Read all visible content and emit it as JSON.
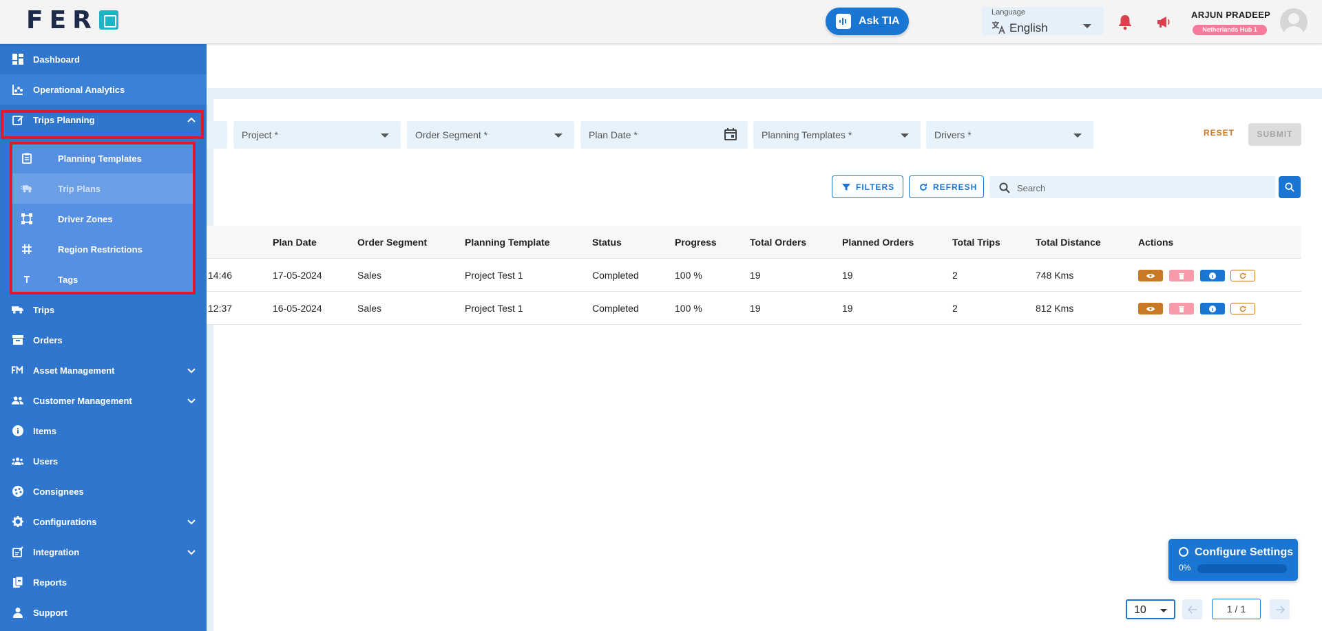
{
  "header": {
    "logo_text": "FER",
    "ask_tia_label": "Ask TIA",
    "language": {
      "caption": "Language",
      "value": "English"
    },
    "user": {
      "name": "ARJUN PRADEEP",
      "badge": "Netherlands Hub 1"
    }
  },
  "sidebar": {
    "items": [
      {
        "label": "Dashboard",
        "icon": "dashboard-icon"
      },
      {
        "label": "Operational Analytics",
        "icon": "analytics-icon"
      },
      {
        "label": "Trips Planning",
        "icon": "trips-planning-icon",
        "expanded": true
      },
      {
        "label": "Trips",
        "icon": "truck-icon"
      },
      {
        "label": "Orders",
        "icon": "orders-box-icon"
      },
      {
        "label": "Asset Management",
        "icon": "fm-icon",
        "expandable": true
      },
      {
        "label": "Customer Management",
        "icon": "people-icon",
        "expandable": true
      },
      {
        "label": "Items",
        "icon": "info-circle-icon"
      },
      {
        "label": "Users",
        "icon": "users-icon"
      },
      {
        "label": "Consignees",
        "icon": "palette-icon"
      },
      {
        "label": "Configurations",
        "icon": "gear-icon",
        "expandable": true
      },
      {
        "label": "Integration",
        "icon": "integration-icon",
        "expandable": true
      },
      {
        "label": "Reports",
        "icon": "reports-icon"
      },
      {
        "label": "Support",
        "icon": "support-icon"
      }
    ],
    "sub_items": [
      {
        "label": "Planning Templates",
        "icon": "clipboard-icon"
      },
      {
        "label": "Trip Plans",
        "icon": "truck-fast-icon",
        "active": true
      },
      {
        "label": "Driver Zones",
        "icon": "zones-icon"
      },
      {
        "label": "Region Restrictions",
        "icon": "hashtag-icon"
      },
      {
        "label": "Tags",
        "icon": "tag-t-icon"
      }
    ]
  },
  "filters": {
    "project": "Project *",
    "order_segment": "Order Segment *",
    "plan_date": "Plan Date *",
    "planning_templates": "Planning Templates *",
    "drivers": "Drivers *",
    "reset_label": "RESET",
    "submit_label": "SUBMIT"
  },
  "toolbar": {
    "filters_label": "FILTERS",
    "refresh_label": "REFRESH",
    "search_placeholder": "Search"
  },
  "table": {
    "headers": [
      "Plan Date",
      "Order Segment",
      "Planning Template",
      "Status",
      "Progress",
      "Total Orders",
      "Planned Orders",
      "Total Trips",
      "Total Distance",
      "Actions"
    ],
    "rows": [
      [
        "14:46",
        "17-05-2024",
        "Sales",
        "Project Test 1",
        "Completed",
        "100 %",
        "19",
        "19",
        "2",
        "748 Kms"
      ],
      [
        "12:37",
        "16-05-2024",
        "Sales",
        "Project Test 1",
        "Completed",
        "100 %",
        "19",
        "19",
        "2",
        "812 Kms"
      ]
    ]
  },
  "configure_settings": {
    "title": "Configure Settings",
    "progress_label": "0%",
    "progress": 0
  },
  "pagination": {
    "page_size": "10",
    "page_indicator": "1 / 1"
  },
  "colors": {
    "sidebar": "#2f76cf",
    "primary": "#1976d2",
    "highlight_box": "#e0192b",
    "reset": "#c77a2a"
  }
}
